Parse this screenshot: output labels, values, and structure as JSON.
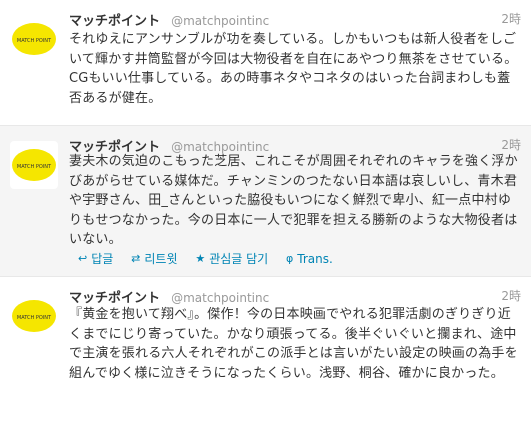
{
  "tweets": [
    {
      "name": "マッチポイント",
      "handle": "@matchpointinc",
      "time": "2時",
      "avatar_text": "MATCH POINT",
      "text": "それゆえにアンサンブルが功を奏している。しかもいつもは新人役者をしごいて輝かす井筒監督が今回は大物役者を自在にあやつり無茶をさせている。CGもいい仕事している。あの時事ネタやコネタのはいった台詞まわしも蓋否あるが健在。"
    },
    {
      "name": "マッチポイント",
      "handle": "@matchpointinc",
      "time": "2時",
      "avatar_text": "MATCH POINT",
      "text": "妻夫木の気迫のこもった芝居、これこそが周囲それぞれのキャラを強く浮かびあがらせている媒体だ。チャンミンのつたない日本語は哀しいし、青木君や宇野さん、田_さんといった脇役もいつになく鮮烈で卑小、紅一点中村ゆりもせつなかった。今の日本に一人で犯罪を担える勝新のような大物役者はいない。",
      "actions": {
        "reply": "답글",
        "retweet": "리트윗",
        "favorite": "관심글 담기",
        "translate": "Trans."
      }
    },
    {
      "name": "マッチポイント",
      "handle": "@matchpointinc",
      "time": "2時",
      "avatar_text": "MATCH POINT",
      "text": "『黄金を抱いて翔べ』。傑作！今の日本映画でやれる犯罪活劇のぎりぎり近くまでにじり寄っていた。かなり頑張ってる。後半ぐいぐいと攔まれ、途中で主演を張れる六人それぞれがこの派手とは言いがたい設定の映画の為手を組んでゆく様に泣きそうになったくらい。浅野、桐谷、確かに良かった。"
    }
  ],
  "colors": {
    "link": "#0084b4",
    "avatar_yellow": "#f5e600"
  }
}
